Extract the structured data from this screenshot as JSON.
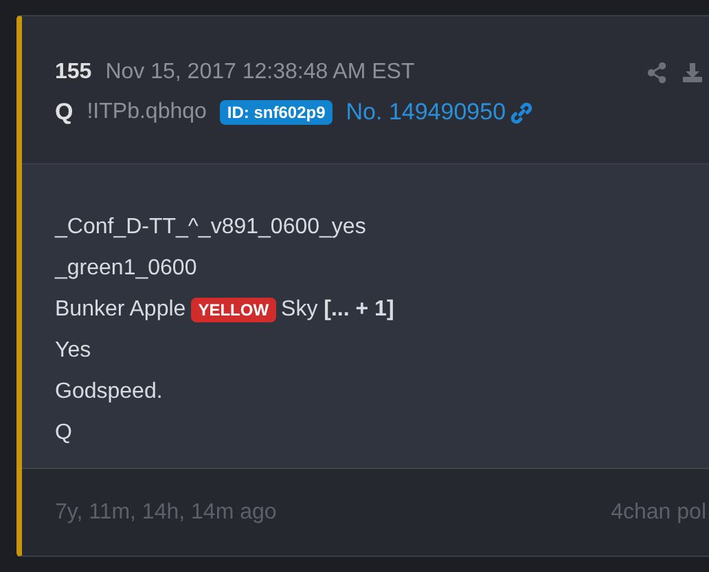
{
  "post": {
    "number": "155",
    "date": "Nov 15, 2017 12:38:48 AM EST",
    "name": "Q",
    "tripcode": "!ITPb.qbhqo",
    "id_badge": "ID: snf602p9",
    "post_no": "No. 149490950"
  },
  "body": [
    {
      "parts": [
        {
          "kind": "text",
          "text": "_Conf_D-TT_^_v891_0600_yes"
        }
      ]
    },
    {
      "parts": [
        {
          "kind": "text",
          "text": "_green1_0600"
        }
      ]
    },
    {
      "parts": [
        {
          "kind": "text",
          "text": "Bunker Apple"
        },
        {
          "kind": "tag",
          "text": "YELLOW"
        },
        {
          "kind": "text",
          "text": "Sky **[... + 1]**"
        }
      ]
    },
    {
      "parts": [
        {
          "kind": "text",
          "text": "Yes"
        }
      ]
    },
    {
      "parts": [
        {
          "kind": "text",
          "text": "Godspeed."
        }
      ]
    },
    {
      "parts": [
        {
          "kind": "text",
          "text": "Q"
        }
      ]
    }
  ],
  "footer": {
    "age": "7y, 11m, 14h, 14m ago",
    "source": "4chan pol"
  }
}
